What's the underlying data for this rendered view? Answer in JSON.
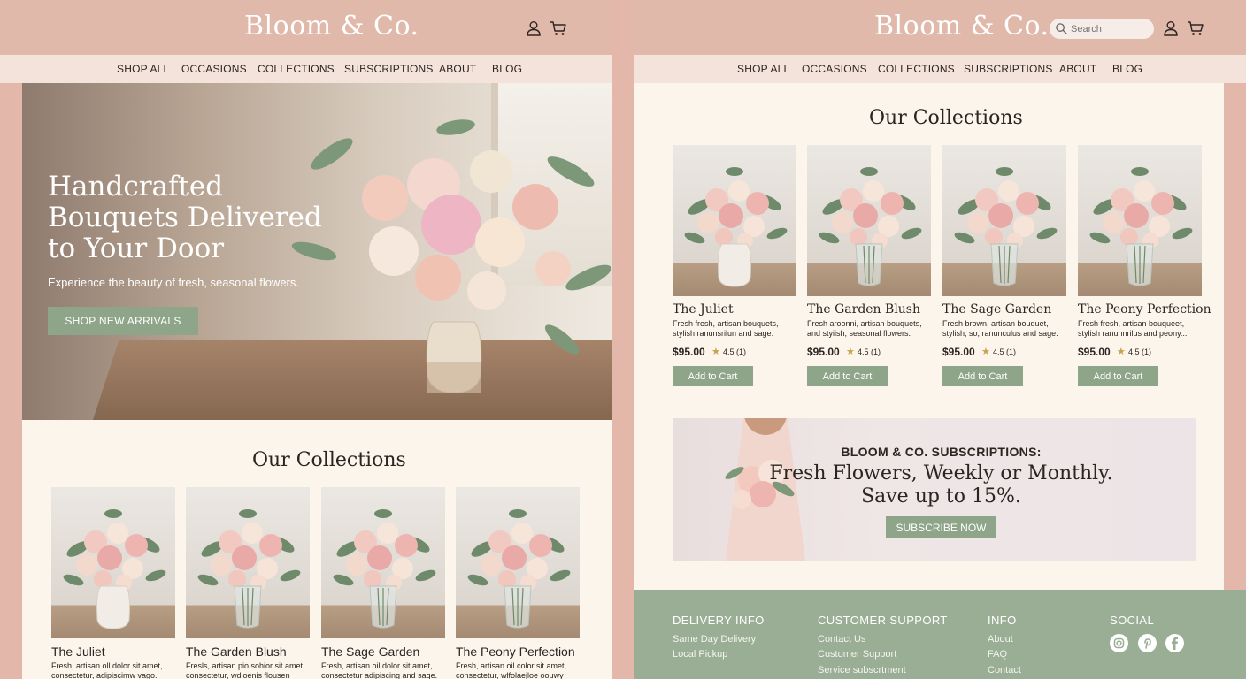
{
  "brand": {
    "name": "Bloom & Co."
  },
  "nav": [
    "SHOP ALL",
    "OCCASIONS",
    "COLLECTIONS",
    "SUBSCRIPTIONS",
    "ABOUT",
    "BLOG"
  ],
  "search": {
    "placeholder": "Search"
  },
  "icons": {
    "account": "user-icon",
    "cart": "cart-icon",
    "search": "search-icon"
  },
  "colors": {
    "header": "#e0b9ab",
    "nav": "#f3e3da",
    "accent_green": "#8ea58a",
    "cream": "#fbf5ec",
    "footer": "#9aae95"
  },
  "hero": {
    "title": "Handcrafted Bouquets Delivered to Your Door",
    "subtitle": "Experience the beauty of fresh, seasonal flowers.",
    "cta": "SHOP NEW ARRIVALS"
  },
  "collections_title": "Our Collections",
  "left_products": [
    {
      "name": "The Juliet",
      "desc": "Fresh, artisan oll dolor sit amet, consectetur, adipiscimw vago."
    },
    {
      "name": "The Garden Blush",
      "desc": "Fresls, artisan pio sohior sit amet, consectetur, wdioenis flousen"
    },
    {
      "name": "The Sage Garden",
      "desc": "Fresh, artisan oil dolor sit amet, consectetur adipiscing and sage."
    },
    {
      "name": "The Peony Perfection",
      "desc": "Fresh, artisan oil color sit amet, consectetur, wlfolaejloe oouwy"
    }
  ],
  "right_products": [
    {
      "name": "The Juliet",
      "desc": "Fresh fresh, artisan bouquets, stylish ranunsrilun and sage.",
      "price": "$95.00",
      "rating": "4.5 (1)",
      "button": "Add to Cart"
    },
    {
      "name": "The Garden Blush",
      "desc": "Fresh aroonni, artisan bouquets, and styiish, seasonal flowers.",
      "price": "$95.00",
      "rating": "4.5 (1)",
      "button": "Add to Cart"
    },
    {
      "name": "The Sage Garden",
      "desc": "Fresh brown, artisan bouquet, stylish, so, ranunculus and sage.",
      "price": "$95.00",
      "rating": "4.5 (1)",
      "button": "Add to Cart"
    },
    {
      "name": "The Peony Perfection",
      "desc": "Fresh fresh, artisan bouqueet, stylish ranunnrilus and peony...",
      "price": "$95.00",
      "rating": "4.5 (1)",
      "button": "Add to Cart"
    }
  ],
  "subscription": {
    "kicker": "BLOOM & CO. SUBSCRIPTIONS:",
    "line1": "Fresh Flowers, Weekly or Monthly.",
    "line2": "Save up to 15%.",
    "cta": "SUBSCRIBE NOW"
  },
  "footer": {
    "delivery": {
      "title": "DELIVERY INFO",
      "links": [
        "Same Day Delivery",
        "Local Pickup"
      ]
    },
    "support": {
      "title": "CUSTOMER SUPPORT",
      "links": [
        "Contact Us",
        "Customer Support",
        "Service subscrtment"
      ]
    },
    "info": {
      "title": "INFO",
      "links": [
        "About",
        "FAQ",
        "Contact"
      ]
    },
    "social": {
      "title": "SOCIAL",
      "icons": [
        "instagram-icon",
        "pinterest-icon",
        "facebook-icon"
      ]
    }
  }
}
